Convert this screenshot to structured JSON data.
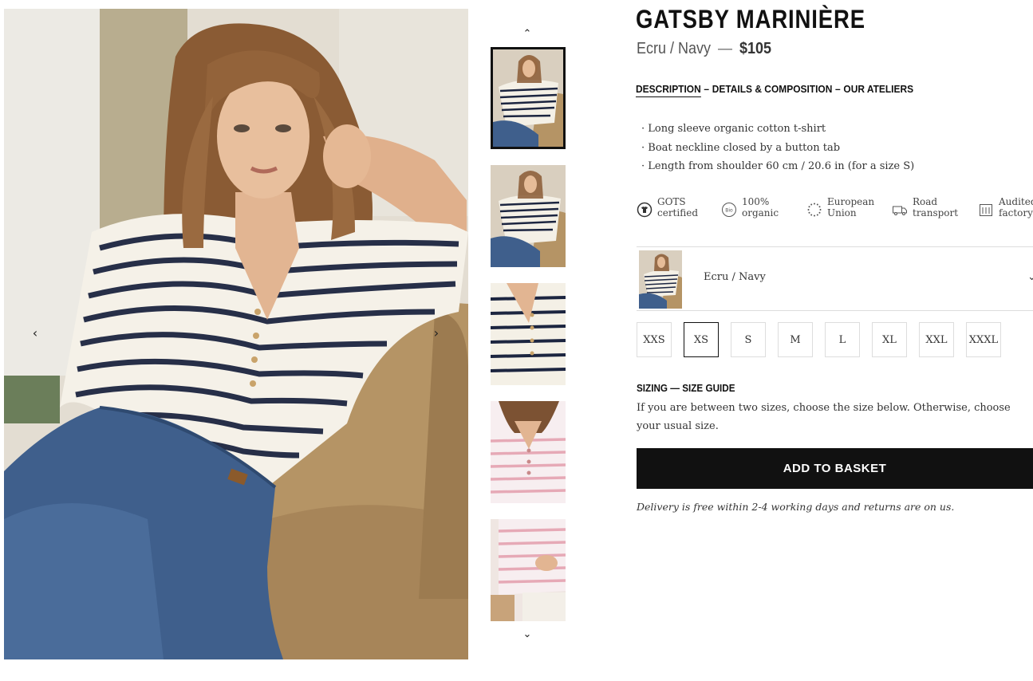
{
  "gallery": {
    "prev_arrow": "‹",
    "next_arrow": "›",
    "thumb_up": "⌃",
    "thumb_down": "⌄"
  },
  "product": {
    "title": "GATSBY MARINIÈRE",
    "color_name": "Ecru / Navy",
    "separator": "—",
    "price": "$105"
  },
  "tabs": [
    {
      "label": "DESCRIPTION",
      "active": true
    },
    {
      "label": "DETAILS & COMPOSITION",
      "active": false
    },
    {
      "label": "OUR ATELIERS",
      "active": false
    }
  ],
  "tab_separator": "–",
  "description_bullets": [
    "· Long sleeve organic cotton t-shirt",
    "· Boat neckline closed by a button tab",
    "· Length from shoulder 60 cm / 20.6 in (for a size S)"
  ],
  "features": [
    {
      "icon": "gots-certified-icon",
      "line1": "GOTS",
      "line2": "certified"
    },
    {
      "icon": "bio-organic-icon",
      "line1": "100%",
      "line2": "organic"
    },
    {
      "icon": "european-union-icon",
      "line1": "European",
      "line2": "Union"
    },
    {
      "icon": "truck-icon",
      "line1": "Road",
      "line2": "transport"
    },
    {
      "icon": "factory-icon",
      "line1": "Audited",
      "line2": "factory"
    }
  ],
  "color_selector": {
    "selected": "Ecru / Navy",
    "chevron": "⌄"
  },
  "sizes": [
    {
      "label": "XXS",
      "selected": false
    },
    {
      "label": "XS",
      "selected": true
    },
    {
      "label": "S",
      "selected": false
    },
    {
      "label": "M",
      "selected": false
    },
    {
      "label": "L",
      "selected": false
    },
    {
      "label": "XL",
      "selected": false
    },
    {
      "label": "XXL",
      "selected": false
    },
    {
      "label": "XXXL",
      "selected": false
    }
  ],
  "sizing": {
    "label": "SIZING",
    "dash": "—",
    "guide_link": "SIZE GUIDE",
    "advice": "If you are between two sizes, choose the size below. Otherwise, choose your usual size."
  },
  "add_to_basket": "ADD TO BASKET",
  "delivery_note": "Delivery is free within 2-4 working days and returns are on us.",
  "colors": {
    "button_bg": "#111111",
    "stripe_navy": "#1c2540",
    "denim": "#3f5f8c",
    "pink_stripe": "#e6a9b6"
  }
}
